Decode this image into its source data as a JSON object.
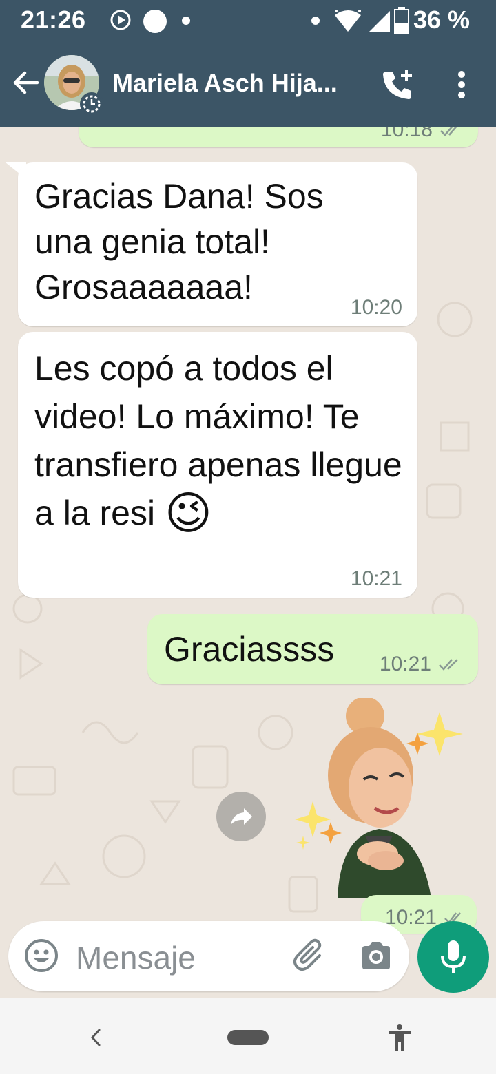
{
  "status_bar": {
    "time": "21:26",
    "battery_percent": "36 %"
  },
  "header": {
    "contact_name": "Mariela Asch Hija..."
  },
  "messages": [
    {
      "direction": "in",
      "text": "Gracias Dana! Sos una genia total! Grosaaaaaaa!",
      "time": "10:20"
    },
    {
      "direction": "in",
      "text": "Les copó a todos el video! Lo máximo! Te transfiero apenas llegue a la resi",
      "time": "10:21",
      "emoji": "😉"
    },
    {
      "direction": "out",
      "text": "Graciassss",
      "time": "10:21",
      "status": "read"
    }
  ],
  "partial_top_message_time": "10:18",
  "sticker_message": {
    "time": "10:21",
    "icon": "sticker-woman-hands-on-chest"
  },
  "input": {
    "placeholder": "Mensaje"
  },
  "icons": {
    "back": "arrow-left-icon",
    "call": "add-call-icon",
    "menu": "more-vert-icon",
    "emoji": "emoji-icon",
    "attach": "paperclip-icon",
    "camera": "camera-icon",
    "mic": "mic-icon",
    "forward": "forward-icon"
  },
  "colors": {
    "header": "#3c5566",
    "outgoing_bubble": "#dcf8c6",
    "incoming_bubble": "#ffffff",
    "accent": "#0f9d7a",
    "chat_background": "#ece5dd"
  }
}
